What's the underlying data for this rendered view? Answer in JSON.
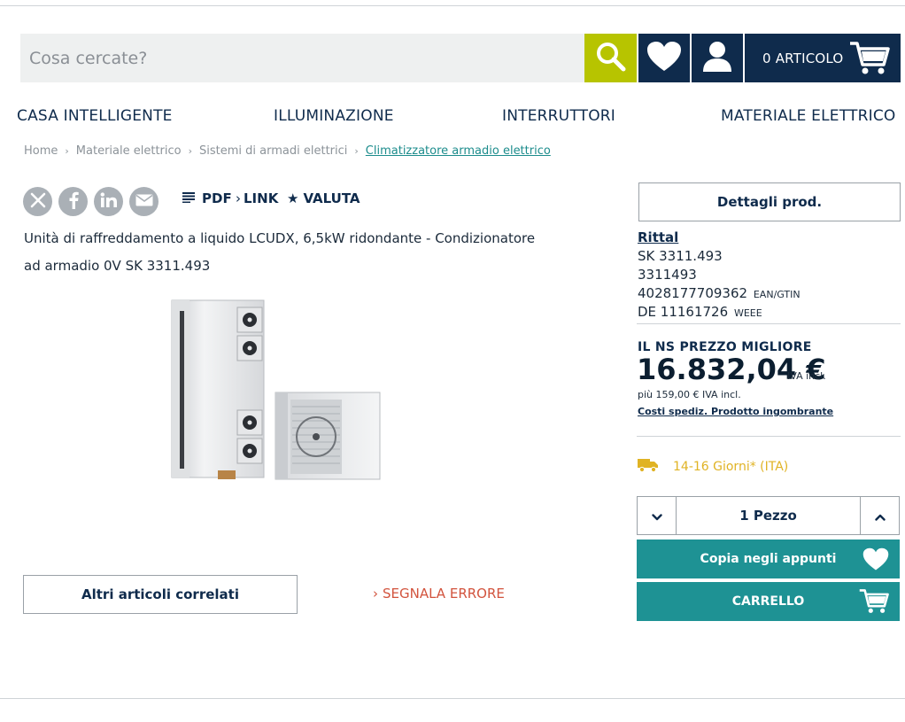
{
  "header": {
    "search_placeholder": "Cosa cercate?",
    "cart_label": "0 ARTICOLO"
  },
  "nav": {
    "items": [
      "CASA INTELLIGENTE",
      "ILLUMINAZIONE",
      "INTERRUTTORI",
      "MATERIALE ELETTRICO"
    ]
  },
  "breadcrumb": {
    "items": [
      "Home",
      "Materiale elettrico",
      "Sistemi di armadi elettrici",
      "Climatizzatore armadio elettrico"
    ]
  },
  "actions": {
    "pdf": "PDF",
    "link": "LINK",
    "rate": "VALUTA"
  },
  "product": {
    "title_line1": "Unità di raffreddamento a liquido LCUDX, 6,5kW ridondante - Condizionatore",
    "title_line2": "ad armadio 0V SK 3311.493",
    "related_button": "Altri articoli correlati",
    "report_error": "SEGNALA ERRORE"
  },
  "details": {
    "button": "Dettagli prod.",
    "brand": "Rittal",
    "model": "SK 3311.493",
    "article_no": "3311493",
    "ean": "4028177709362",
    "ean_label": "EAN/GTIN",
    "weee": "DE 11161726",
    "weee_label": "WEEE"
  },
  "pricing": {
    "heading": "IL NS PREZZO MIGLIORE",
    "price": "16.832,04 €",
    "tax_note": "IVA incl.",
    "shipping_extra": "più 159,00 € IVA incl.",
    "shipping_link": "Costi spediz. Prodotto ingombrante"
  },
  "delivery": {
    "text": "14-16 Giorni* (ITA)"
  },
  "quantity": {
    "value": "1 Pezzo"
  },
  "buttons": {
    "wishlist": "Copia negli appunti",
    "cart": "CARRELLO"
  },
  "colors": {
    "navy": "#0f2b4c",
    "lime": "#b7c400",
    "teal": "#1e9294",
    "delivery": "#e0b324",
    "error": "#d2533d"
  },
  "icons": [
    "search-icon",
    "heart-icon",
    "user-icon",
    "cart-icon",
    "x-icon",
    "facebook-icon",
    "linkedin-icon",
    "mail-icon",
    "lines-icon",
    "chevron-right-icon",
    "star-icon",
    "truck-icon",
    "chevron-down-icon",
    "chevron-up-icon"
  ]
}
